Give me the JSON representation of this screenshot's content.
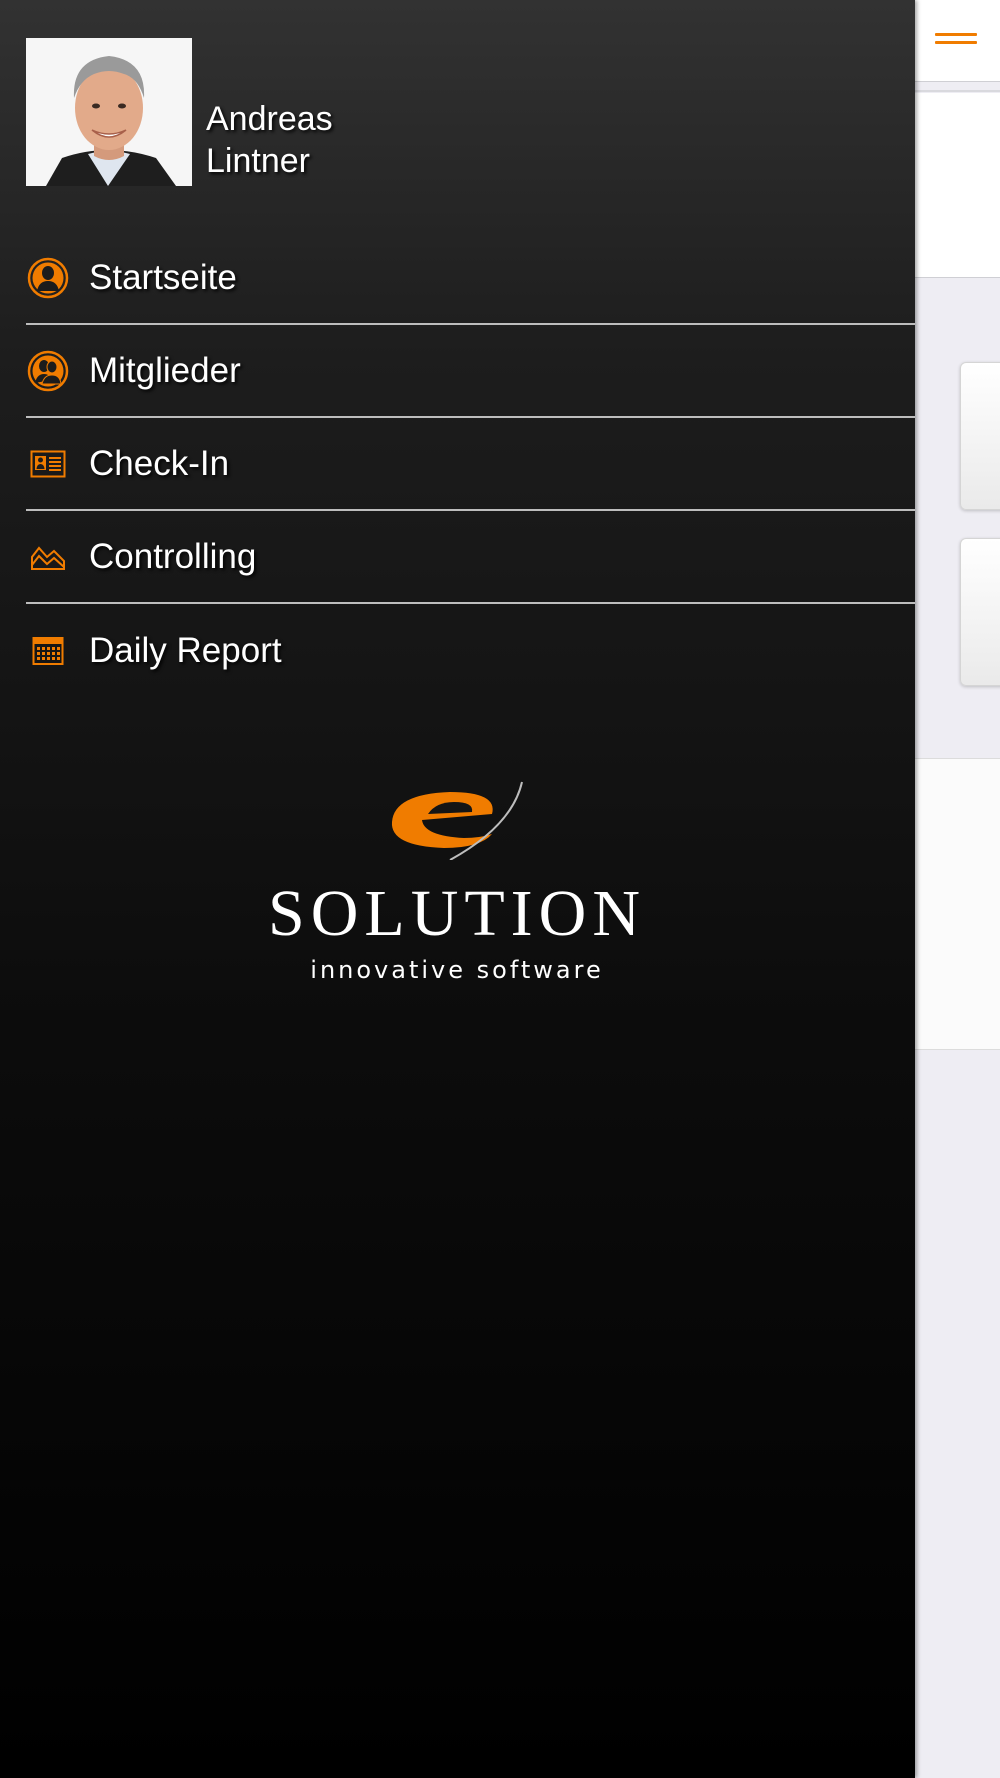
{
  "user": {
    "first_name": "Andreas",
    "last_name": "Lintner"
  },
  "menu": {
    "items": [
      {
        "label": "Startseite",
        "icon": "person-icon"
      },
      {
        "label": "Mitglieder",
        "icon": "group-icon"
      },
      {
        "label": "Check-In",
        "icon": "id-card-icon"
      },
      {
        "label": "Controlling",
        "icon": "chart-icon"
      },
      {
        "label": "Daily Report",
        "icon": "calendar-icon"
      }
    ]
  },
  "logo": {
    "wordmark": "SOLUTION",
    "tagline": "innovative software"
  },
  "colors": {
    "accent": "#f07c00",
    "drawer_top": "#323232",
    "drawer_bottom": "#000000",
    "page_background": "#eeedf3"
  }
}
